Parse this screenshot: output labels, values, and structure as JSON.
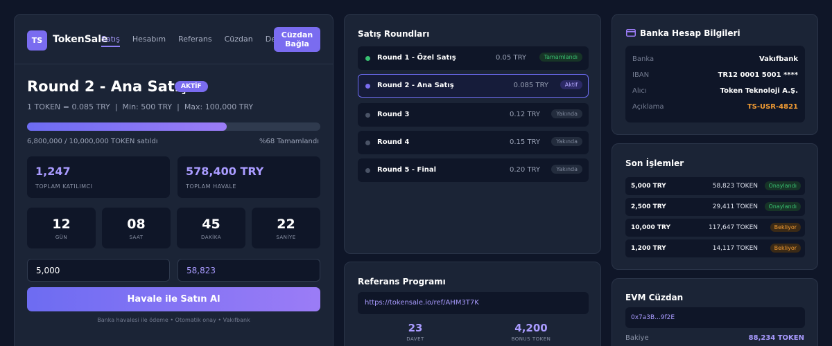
{
  "header": {
    "logo_text": "TS",
    "brand": "TokenSale",
    "nav": [
      "Satış",
      "Hesabım",
      "Referans",
      "Cüzdan",
      "Destek"
    ],
    "wallet_button_line1": "Cüzdan",
    "wallet_button_line2": "Bağla"
  },
  "sale": {
    "title": "Round 2 - Ana Satış",
    "badge": "AKTİF",
    "price_line": "1 TOKEN = 0.085 TRY  |  Min: 500 TRY  |  Max: 100,000 TRY",
    "progress_fraction": 0.68,
    "sold_text": "6,800,000 / 10,000,000 TOKEN satıldı",
    "percent_text": "%68 Tamamlandı",
    "stats": [
      {
        "value": "1,247",
        "label": "TOPLAM KATILIMCI"
      },
      {
        "value": "578,400 TRY",
        "label": "TOPLAM HAVALE"
      }
    ],
    "countdown": [
      {
        "value": "12",
        "unit": "GÜN"
      },
      {
        "value": "08",
        "unit": "SAAT"
      },
      {
        "value": "45",
        "unit": "DAKİKA"
      },
      {
        "value": "22",
        "unit": "SANİYE"
      }
    ],
    "amount_value": "5,000",
    "token_value": "58,823",
    "buy_button": "Havale ile Satın Al",
    "note": "Banka havalesi ile ödeme • Otomatik onay • Vakıfbank"
  },
  "rounds": {
    "title": "Satış Roundları",
    "items": [
      {
        "name": "Round 1 - Özel Satış",
        "price": "0.05 TRY",
        "status": "Tamamlandı",
        "state": "done"
      },
      {
        "name": "Round 2 - Ana Satış",
        "price": "0.085 TRY",
        "status": "Aktif",
        "state": "active"
      },
      {
        "name": "Round 3",
        "price": "0.12 TRY",
        "status": "Yakında",
        "state": "soon"
      },
      {
        "name": "Round 4",
        "price": "0.15 TRY",
        "status": "Yakında",
        "state": "soon"
      },
      {
        "name": "Round 5 - Final",
        "price": "0.20 TRY",
        "status": "Yakında",
        "state": "soon"
      }
    ]
  },
  "referral": {
    "title": "Referans Programı",
    "link": "https://tokensale.io/ref/AHM3T7K",
    "stats": [
      {
        "value": "23",
        "label": "DAVET"
      },
      {
        "value": "4,200",
        "label": "BONUS TOKEN"
      }
    ]
  },
  "bank": {
    "title": "Banka Hesap Bilgileri",
    "rows": [
      {
        "key": "Banka",
        "value": "Vakıfbank"
      },
      {
        "key": "IBAN",
        "value": "TR12 0001 5001 ****"
      },
      {
        "key": "Alıcı",
        "value": "Token Teknoloji A.Ş."
      },
      {
        "key": "Açıklama",
        "value": "TS-USR-4821"
      }
    ]
  },
  "transactions": {
    "title": "Son İşlemler",
    "rows": [
      {
        "amount": "5,000 TRY",
        "tokens": "58,823 TOKEN",
        "status": "Onaylandı",
        "state": "ok"
      },
      {
        "amount": "2,500 TRY",
        "tokens": "29,411 TOKEN",
        "status": "Onaylandı",
        "state": "ok"
      },
      {
        "amount": "10,000 TRY",
        "tokens": "117,647 TOKEN",
        "status": "Bekliyor",
        "state": "wait"
      },
      {
        "amount": "1,200 TRY",
        "tokens": "14,117 TOKEN",
        "status": "Bekliyor",
        "state": "wait"
      }
    ]
  },
  "evm": {
    "title": "EVM Cüzdan",
    "address": "0x7a3B...9f2E",
    "balance_label": "Bakiye",
    "balance_value": "88,234 TOKEN"
  },
  "colors": {
    "accent": "#7a6cf0",
    "success": "#38c172",
    "warning": "#f39c33",
    "background": "#0f1628",
    "card": "#1b2436"
  }
}
